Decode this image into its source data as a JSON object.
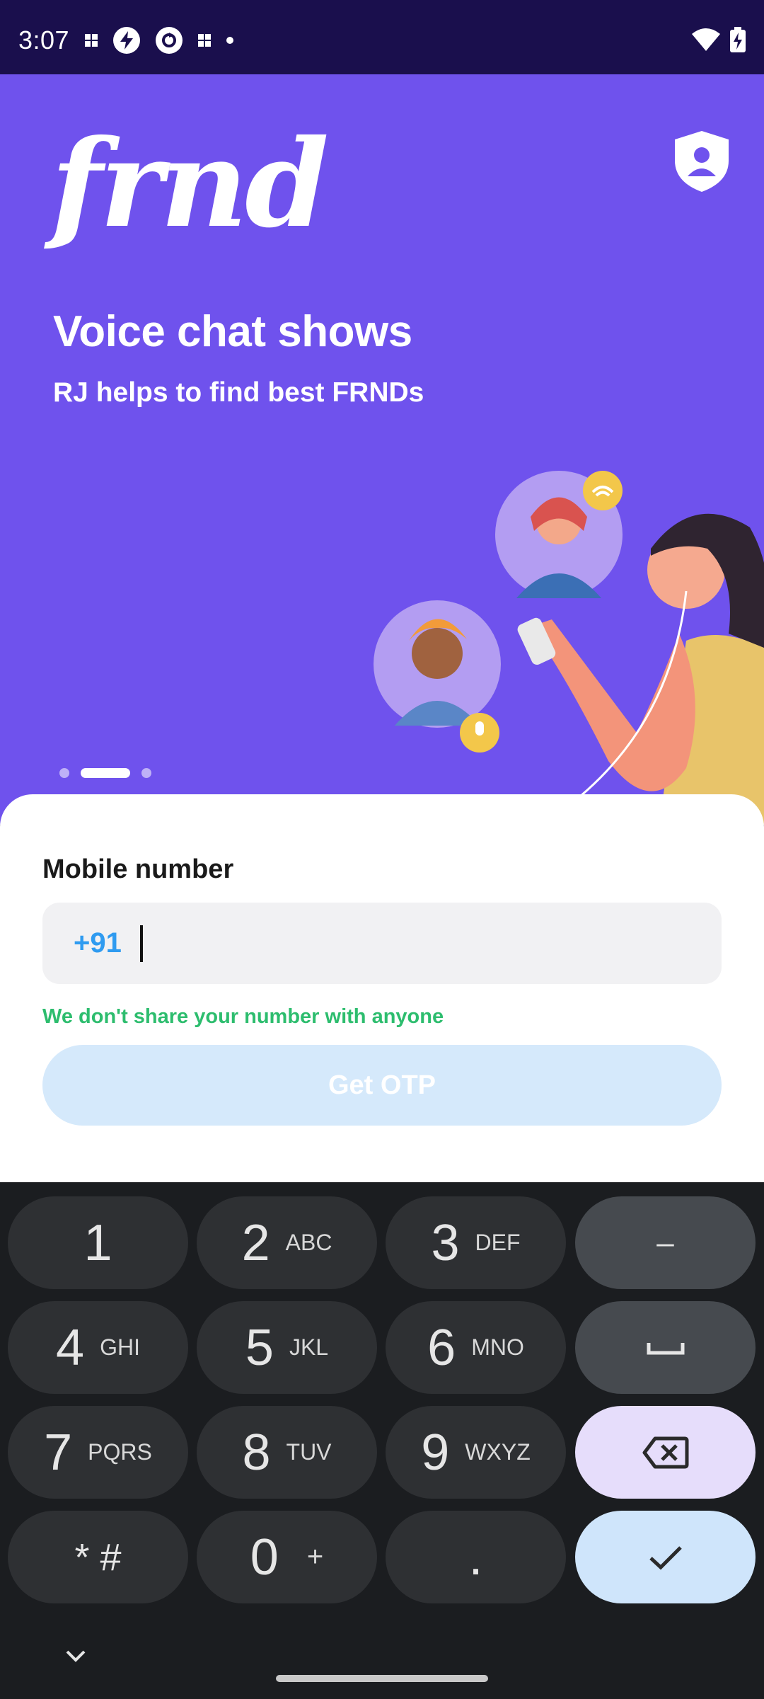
{
  "status_bar": {
    "time": "3:07",
    "icons": [
      "small-grid-icon",
      "bolt-circle-icon",
      "sync-circle-icon",
      "small-grid-icon",
      "dot-icon",
      "wifi-icon",
      "battery-charging-icon"
    ]
  },
  "hero": {
    "logo": "frnd",
    "title": "Voice chat shows",
    "subtitle": "RJ helps to find best FRNDs",
    "carousel": {
      "page_count": 3,
      "active_index": 1
    }
  },
  "form": {
    "label": "Mobile number",
    "country_code": "+91",
    "phone_value": "",
    "privacy_note": "We don't share your number with anyone",
    "button_label": "Get OTP"
  },
  "keyboard": {
    "rows": [
      [
        {
          "num": "1",
          "letters": ""
        },
        {
          "num": "2",
          "letters": "ABC"
        },
        {
          "num": "3",
          "letters": "DEF"
        },
        {
          "sym": "–"
        }
      ],
      [
        {
          "num": "4",
          "letters": "GHI"
        },
        {
          "num": "5",
          "letters": "JKL"
        },
        {
          "num": "6",
          "letters": "MNO"
        },
        {
          "sym": "space"
        }
      ],
      [
        {
          "num": "7",
          "letters": "PQRS"
        },
        {
          "num": "8",
          "letters": "TUV"
        },
        {
          "num": "9",
          "letters": "WXYZ"
        },
        {
          "sym": "backspace"
        }
      ],
      [
        {
          "num": "* #",
          "letters": ""
        },
        {
          "num": "0",
          "letters": "+"
        },
        {
          "num": ".",
          "letters": ""
        },
        {
          "sym": "done"
        }
      ]
    ]
  },
  "colors": {
    "status_bar": "#1a0f4d",
    "hero_bg": "#6f52ed",
    "country_code": "#2f9bf0",
    "privacy_note": "#2dbd6e",
    "otp_button_disabled": "#d5e9fb"
  }
}
